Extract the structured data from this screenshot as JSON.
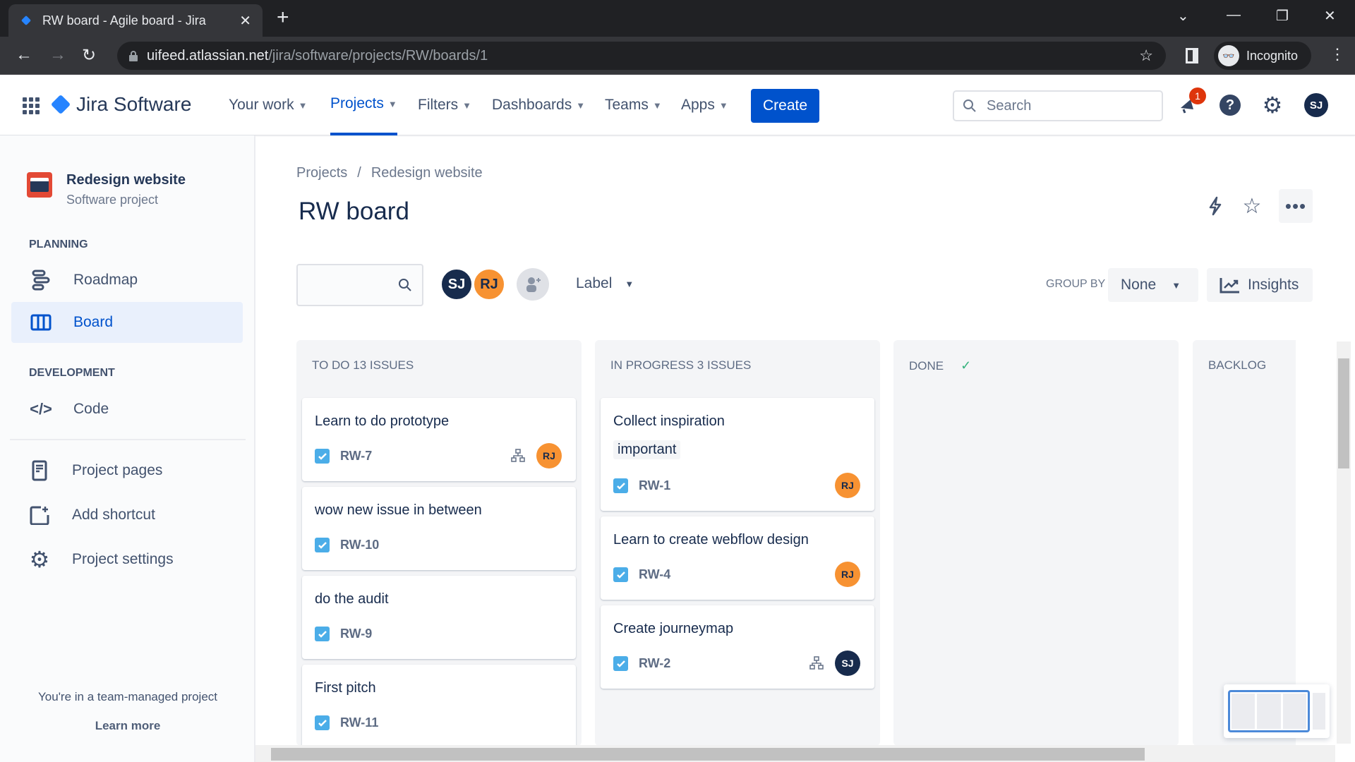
{
  "browser": {
    "tab_title": "RW board - Agile board - Jira",
    "url_host": "uifeed.atlassian.net",
    "url_path": "/jira/software/projects/RW/boards/1",
    "profile_label": "Incognito"
  },
  "topnav": {
    "product": "Jira Software",
    "items": [
      {
        "label": "Your work",
        "active": false
      },
      {
        "label": "Projects",
        "active": true
      },
      {
        "label": "Filters",
        "active": false
      },
      {
        "label": "Dashboards",
        "active": false
      },
      {
        "label": "Teams",
        "active": false
      },
      {
        "label": "Apps",
        "active": false
      }
    ],
    "create_label": "Create",
    "search_placeholder": "Search",
    "notification_count": "1",
    "user_initials": "SJ"
  },
  "sidebar": {
    "project_name": "Redesign website",
    "project_type": "Software project",
    "planning_heading": "PLANNING",
    "development_heading": "DEVELOPMENT",
    "items": [
      {
        "label": "Roadmap",
        "icon": "roadmap-icon"
      },
      {
        "label": "Board",
        "icon": "board-icon",
        "active": true
      },
      {
        "label": "Code",
        "icon": "code-icon"
      },
      {
        "label": "Project pages",
        "icon": "pages-icon"
      },
      {
        "label": "Add shortcut",
        "icon": "add-shortcut-icon"
      },
      {
        "label": "Project settings",
        "icon": "gear-icon"
      }
    ],
    "footer_text": "You're in a team-managed project",
    "learn_more": "Learn more"
  },
  "main": {
    "breadcrumb": [
      "Projects",
      "Redesign website"
    ],
    "breadcrumb_sep": "/",
    "title": "RW board",
    "filter_avatars": [
      "SJ",
      "RJ"
    ],
    "label_filter": "Label",
    "group_by_label": "GROUP BY",
    "group_by_value": "None",
    "insights_label": "Insights"
  },
  "columns": [
    {
      "header": "TO DO 13 ISSUES",
      "cards": [
        {
          "title": "Learn to do prototype",
          "key": "RW-7",
          "assignee": "RJ",
          "subtasks": true
        },
        {
          "title": "wow new issue in between",
          "key": "RW-10"
        },
        {
          "title": "do the audit",
          "key": "RW-9"
        },
        {
          "title": "First pitch",
          "key": "RW-11"
        }
      ]
    },
    {
      "header": "IN PROGRESS 3 ISSUES",
      "cards": [
        {
          "title": "Collect inspiration",
          "label": "important",
          "key": "RW-1",
          "assignee": "RJ"
        },
        {
          "title": "Learn to create webflow design",
          "key": "RW-4",
          "assignee": "RJ"
        },
        {
          "title": "Create journeymap",
          "key": "RW-2",
          "assignee": "SJ",
          "subtasks": true
        }
      ]
    },
    {
      "header": "DONE",
      "done_check": "✓",
      "cards": []
    },
    {
      "header": "BACKLOG",
      "cards": []
    }
  ],
  "colors": {
    "brand": "#0052cc",
    "rj": "#f79232",
    "sj": "#172b4d",
    "checkbox": "#4bade8",
    "notification": "#de350b"
  }
}
